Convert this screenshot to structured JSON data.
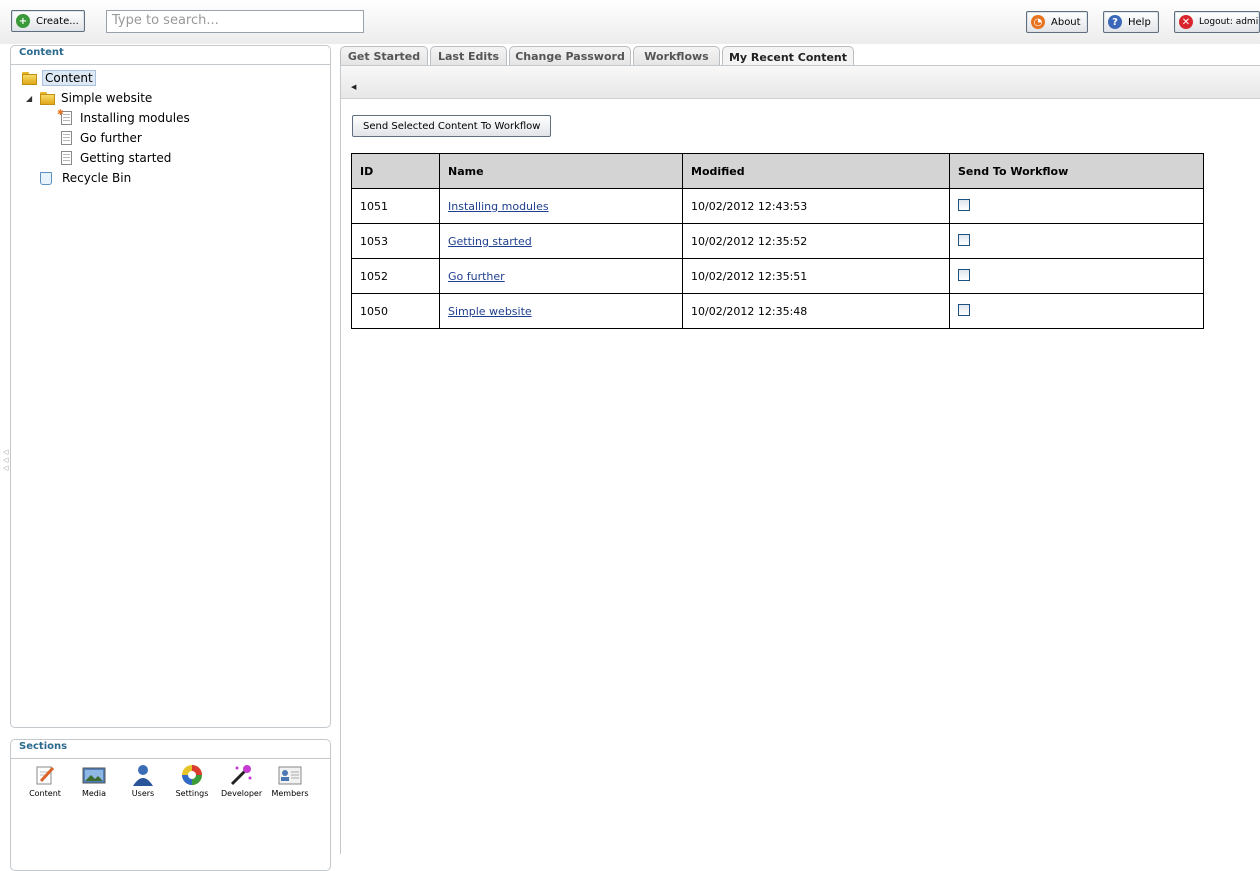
{
  "toolbar": {
    "create_label": "Create...",
    "search_placeholder": "Type to search...",
    "about_label": "About",
    "help_label": "Help",
    "logout_label": "Logout: admin"
  },
  "content_panel": {
    "title": "Content",
    "tree": {
      "root": "Content",
      "site": "Simple website",
      "children": [
        "Installing modules",
        "Go further",
        "Getting started"
      ],
      "recycle": "Recycle Bin"
    }
  },
  "sections_panel": {
    "title": "Sections",
    "items": [
      "Content",
      "Media",
      "Users",
      "Settings",
      "Developer",
      "Members"
    ]
  },
  "tabs": [
    "Get Started",
    "Last Edits",
    "Change Password",
    "Workflows",
    "My Recent Content"
  ],
  "active_tab": "My Recent Content",
  "workflow_button": "Send Selected Content To Workflow",
  "table": {
    "headers": [
      "ID",
      "Name",
      "Modified",
      "Send To Workflow"
    ],
    "rows": [
      {
        "id": "1051",
        "name": "Installing modules",
        "modified": "10/02/2012 12:43:53"
      },
      {
        "id": "1053",
        "name": "Getting started",
        "modified": "10/02/2012 12:35:52"
      },
      {
        "id": "1052",
        "name": "Go further",
        "modified": "10/02/2012 12:35:51"
      },
      {
        "id": "1050",
        "name": "Simple website",
        "modified": "10/02/2012 12:35:48"
      }
    ]
  },
  "colors": {
    "panel_title": "#2b6a8e",
    "link": "#1f3f8f",
    "selected_bg": "#dde8f5"
  }
}
